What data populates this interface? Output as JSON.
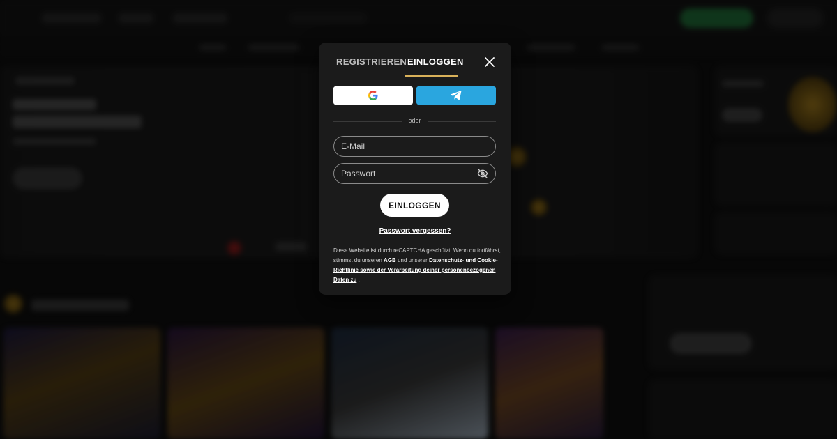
{
  "modal": {
    "tabs": [
      {
        "label": "REGISTRIEREN",
        "active": false
      },
      {
        "label": "EINLOGGEN",
        "active": true
      }
    ],
    "social": {
      "google_icon": "google-icon",
      "telegram_icon": "telegram-icon",
      "telegram_color": "#2aa6df"
    },
    "divider_text": "oder",
    "email_placeholder": "E-Mail",
    "password_placeholder": "Passwort",
    "submit_label": "EINLOGGEN",
    "forgot_label": "Passwort vergessen?",
    "legal": {
      "text1": "Diese Website ist durch reCAPTCHA geschützt. Wenn du fortfährst, stimmst du unseren",
      "agb_link": "AGB",
      "text2": "und unserer",
      "privacy_link": "Datenschutz- und Cookie-Richtlinie sowie der Verarbeitung deiner personenbezogenen Daten zu",
      "text3": "."
    },
    "accent_color": "#d9b15a"
  }
}
